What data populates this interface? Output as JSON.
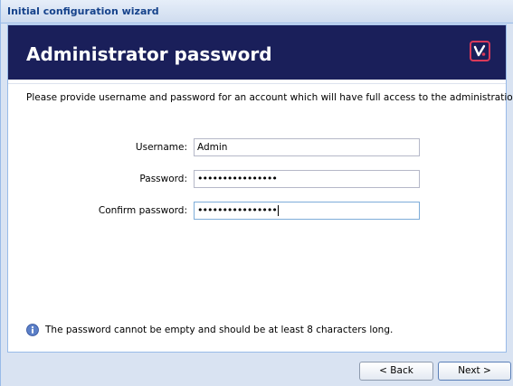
{
  "window": {
    "title": "Initial configuration wizard"
  },
  "header": {
    "title": "Administrator password",
    "logo_icon": "brand-logo-icon",
    "background": "#1a1f5a",
    "accent": "#d93a5a"
  },
  "intro_text": "Please provide username and password for an account which will have full access to the administration.",
  "form": {
    "username": {
      "label": "Username:",
      "value": "Admin"
    },
    "password": {
      "label": "Password:",
      "value": "••••••••••••••••"
    },
    "confirm_password": {
      "label": "Confirm password:",
      "value": "••••••••••••••••"
    }
  },
  "info": {
    "icon": "info-icon",
    "text": "The password cannot be empty and should be at least 8 characters long."
  },
  "buttons": {
    "back": "< Back",
    "next": "Next >"
  }
}
